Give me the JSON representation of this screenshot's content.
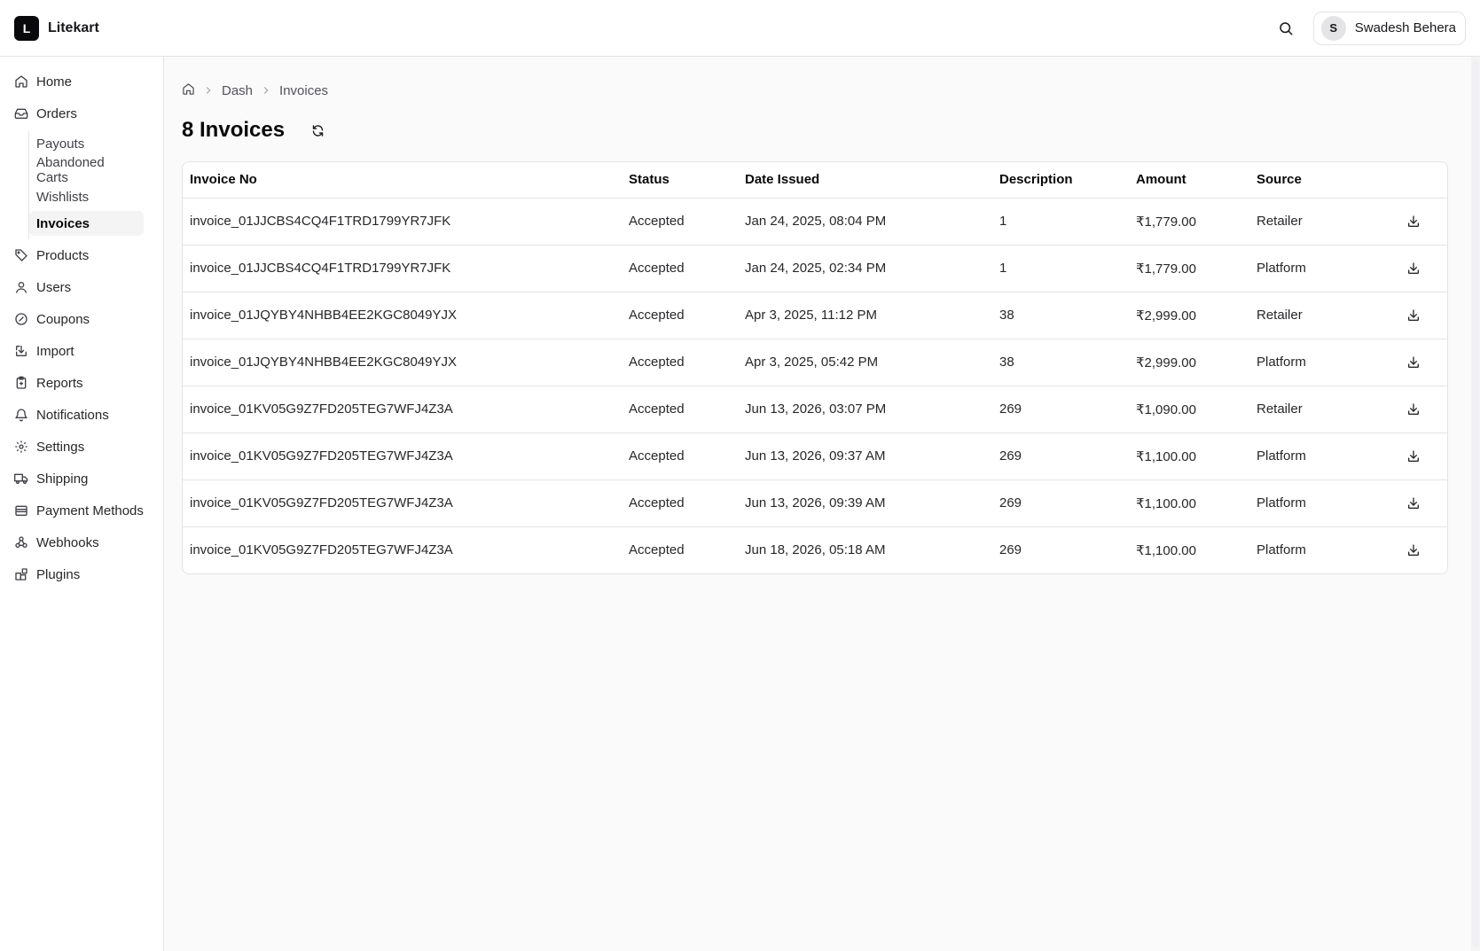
{
  "app": {
    "logo_letter": "L",
    "name": "Litekart"
  },
  "user": {
    "initial": "S",
    "name": "Swadesh Behera"
  },
  "sidebar": {
    "items": [
      {
        "label": "Home",
        "icon": "home-icon"
      },
      {
        "label": "Orders",
        "icon": "inbox-icon"
      },
      {
        "label": "Products",
        "icon": "tag-icon"
      },
      {
        "label": "Users",
        "icon": "user-icon"
      },
      {
        "label": "Coupons",
        "icon": "percent-badge-icon"
      },
      {
        "label": "Import",
        "icon": "import-icon"
      },
      {
        "label": "Reports",
        "icon": "clipboard-icon"
      },
      {
        "label": "Notifications",
        "icon": "bell-icon"
      },
      {
        "label": "Settings",
        "icon": "gear-icon"
      },
      {
        "label": "Shipping",
        "icon": "truck-icon"
      },
      {
        "label": "Payment Methods",
        "icon": "wallet-icon"
      },
      {
        "label": "Webhooks",
        "icon": "webhook-icon"
      },
      {
        "label": "Plugins",
        "icon": "blocks-icon"
      }
    ],
    "orders_sub": [
      "Payouts",
      "Abandoned Carts",
      "Wishlists",
      "Invoices"
    ],
    "active_sub": "Invoices"
  },
  "breadcrumb": {
    "items": [
      "Dash",
      "Invoices"
    ]
  },
  "page": {
    "title": "8 Invoices"
  },
  "table": {
    "columns": [
      "Invoice No",
      "Status",
      "Date Issued",
      "Description",
      "Amount",
      "Source"
    ],
    "rows": [
      [
        "invoice_01JJCBS4CQ4F1TRD1799YR7JFK",
        "Accepted",
        "Jan 24, 2025, 08:04 PM",
        "1",
        "₹1,779.00",
        "Retailer"
      ],
      [
        "invoice_01JJCBS4CQ4F1TRD1799YR7JFK",
        "Accepted",
        "Jan 24, 2025, 02:34 PM",
        "1",
        "₹1,779.00",
        "Platform"
      ],
      [
        "invoice_01JQYBY4NHBB4EE2KGC8049YJX",
        "Accepted",
        "Apr 3, 2025, 11:12 PM",
        "38",
        "₹2,999.00",
        "Retailer"
      ],
      [
        "invoice_01JQYBY4NHBB4EE2KGC8049YJX",
        "Accepted",
        "Apr 3, 2025, 05:42 PM",
        "38",
        "₹2,999.00",
        "Platform"
      ],
      [
        "invoice_01KV05G9Z7FD205TEG7WFJ4Z3A",
        "Accepted",
        "Jun 13, 2026, 03:07 PM",
        "269",
        "₹1,090.00",
        "Retailer"
      ],
      [
        "invoice_01KV05G9Z7FD205TEG7WFJ4Z3A",
        "Accepted",
        "Jun 13, 2026, 09:37 AM",
        "269",
        "₹1,100.00",
        "Platform"
      ],
      [
        "invoice_01KV05G9Z7FD205TEG7WFJ4Z3A",
        "Accepted",
        "Jun 13, 2026, 09:39 AM",
        "269",
        "₹1,100.00",
        "Platform"
      ],
      [
        "invoice_01KV05G9Z7FD205TEG7WFJ4Z3A",
        "Accepted",
        "Jun 18, 2026, 05:18 AM",
        "269",
        "₹1,100.00",
        "Platform"
      ]
    ]
  }
}
